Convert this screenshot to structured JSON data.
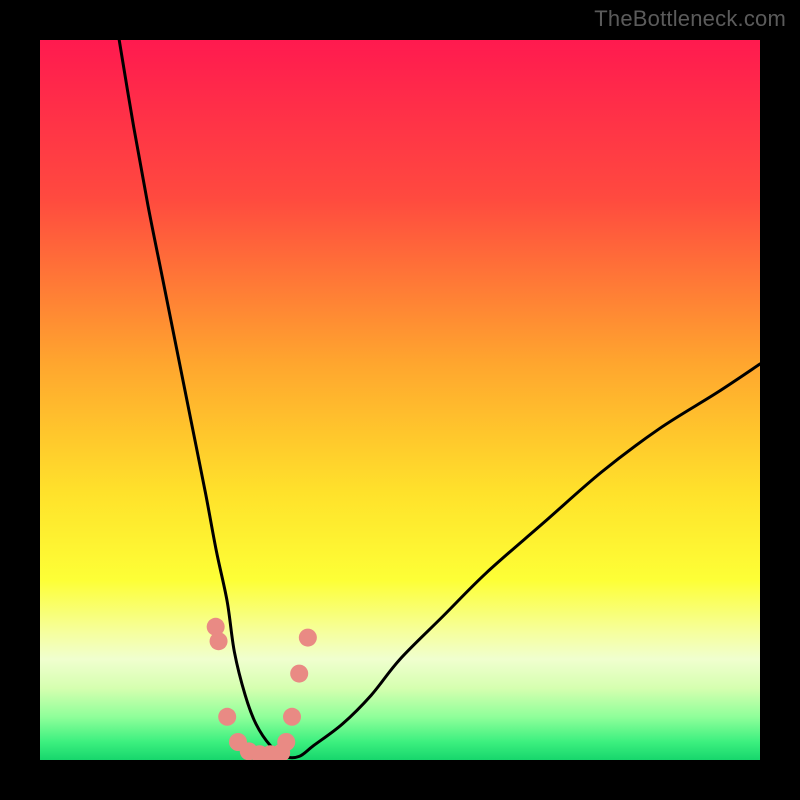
{
  "watermark": "TheBottleneck.com",
  "chart_data": {
    "type": "line",
    "title": "",
    "xlabel": "",
    "ylabel": "",
    "xlim": [
      0,
      100
    ],
    "ylim": [
      0,
      100
    ],
    "grid": false,
    "legend": false,
    "gradient_stops": [
      {
        "pos": 0.0,
        "color": "#ff1a4f"
      },
      {
        "pos": 0.22,
        "color": "#ff4a3f"
      },
      {
        "pos": 0.45,
        "color": "#ffa62e"
      },
      {
        "pos": 0.63,
        "color": "#ffe22b"
      },
      {
        "pos": 0.75,
        "color": "#fdff36"
      },
      {
        "pos": 0.82,
        "color": "#f6ff9a"
      },
      {
        "pos": 0.86,
        "color": "#f0ffcf"
      },
      {
        "pos": 0.9,
        "color": "#d6ffb0"
      },
      {
        "pos": 0.94,
        "color": "#8fff9a"
      },
      {
        "pos": 0.975,
        "color": "#3cf07f"
      },
      {
        "pos": 1.0,
        "color": "#17d66c"
      }
    ],
    "series": [
      {
        "name": "bottleneck-curve",
        "color": "#000000",
        "x": [
          11,
          13,
          15,
          17,
          19,
          21,
          23,
          24.5,
          26,
          27,
          28.5,
          30,
          32,
          34,
          36,
          38,
          42,
          46,
          50,
          56,
          62,
          70,
          78,
          86,
          94,
          100
        ],
        "y": [
          100,
          88,
          77,
          67,
          57,
          47,
          37,
          29,
          22,
          15,
          9,
          5,
          2,
          0.5,
          0.5,
          2,
          5,
          9,
          14,
          20,
          26,
          33,
          40,
          46,
          51,
          55
        ]
      },
      {
        "name": "marker-dots",
        "color": "#e98a84",
        "type": "scatter",
        "x": [
          24.4,
          24.8,
          26.0,
          27.5,
          29.0,
          30.5,
          32.0,
          33.5,
          34.2,
          35.0,
          36.0,
          37.2
        ],
        "y": [
          18.5,
          16.5,
          6.0,
          2.5,
          1.2,
          0.8,
          0.8,
          1.0,
          2.5,
          6.0,
          12.0,
          17.0
        ]
      }
    ]
  }
}
